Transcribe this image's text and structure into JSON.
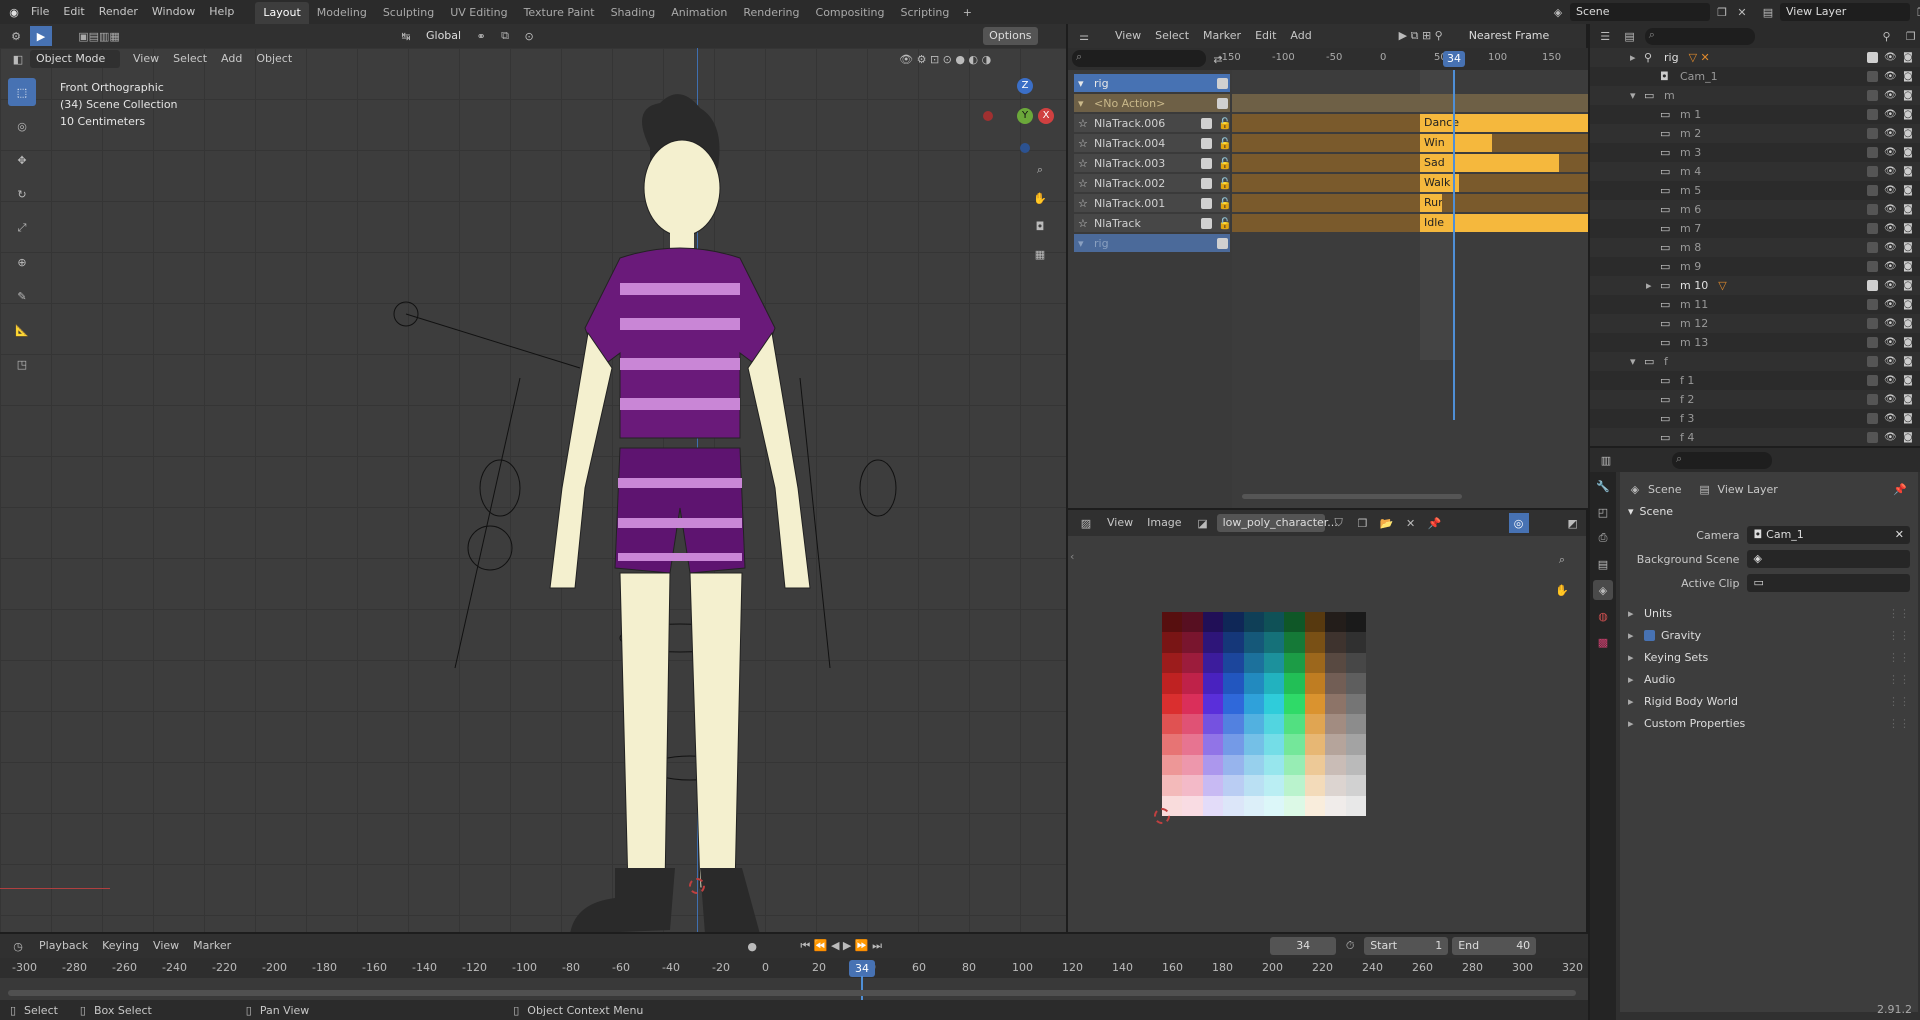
{
  "topbar": {
    "menus": [
      "File",
      "Edit",
      "Render",
      "Window",
      "Help"
    ],
    "workspaces": [
      "Layout",
      "Modeling",
      "Sculpting",
      "UV Editing",
      "Texture Paint",
      "Shading",
      "Animation",
      "Rendering",
      "Compositing",
      "Scripting"
    ],
    "active_workspace": "Layout",
    "scene": "Scene",
    "view_layer": "View Layer"
  },
  "viewport": {
    "mode": "Object Mode",
    "menus": [
      "View",
      "Select",
      "Add",
      "Object"
    ],
    "orientation": "Global",
    "options": "Options",
    "overlay_lines": [
      "Front Orthographic",
      "(34) Scene Collection",
      "10 Centimeters"
    ],
    "gizmo": {
      "z": "Z",
      "y": "Y",
      "x": "X"
    }
  },
  "nla": {
    "menus": [
      "View",
      "Select",
      "Marker",
      "Edit",
      "Add"
    ],
    "snap": "Nearest Frame",
    "ruler": [
      "-150",
      "-100",
      "-50",
      "0",
      "50",
      "100",
      "150"
    ],
    "current_frame": "34",
    "tracks": [
      {
        "name": "rig",
        "type": "object"
      },
      {
        "name": "<No Action>",
        "type": "action"
      },
      {
        "name": "NlaTrack.006",
        "strip": "Dance",
        "strip_frac": 1.0
      },
      {
        "name": "NlaTrack.004",
        "strip": "Win",
        "strip_frac": 0.43
      },
      {
        "name": "NlaTrack.003",
        "strip": "Sad",
        "strip_frac": 0.83
      },
      {
        "name": "NlaTrack.002",
        "strip": "Walk",
        "strip_frac": 0.23
      },
      {
        "name": "NlaTrack.001",
        "strip": "Run",
        "strip_frac": 0.12
      },
      {
        "name": "NlaTrack",
        "strip": "Idle",
        "strip_frac": 1.0
      },
      {
        "name": "rig",
        "type": "object2"
      }
    ]
  },
  "image_editor": {
    "menus": [
      "View",
      "Image"
    ],
    "image_name": "low_poly_character..."
  },
  "outliner": {
    "items": [
      {
        "label": "rig",
        "indent": 0,
        "expander": "▸",
        "icon": "armature-icon",
        "checked": true,
        "extra": "▽ ✕"
      },
      {
        "label": "Cam_1",
        "indent": 1,
        "icon": "camera-icon",
        "checked": false
      },
      {
        "label": "m",
        "indent": 0,
        "expander": "▾",
        "icon": "collection-icon",
        "checked": false
      },
      {
        "label": "m 1",
        "indent": 1,
        "icon": "collection-icon",
        "checked": false
      },
      {
        "label": "m 2",
        "indent": 1,
        "icon": "collection-icon",
        "checked": false
      },
      {
        "label": "m 3",
        "indent": 1,
        "icon": "collection-icon",
        "checked": false
      },
      {
        "label": "m 4",
        "indent": 1,
        "icon": "collection-icon",
        "checked": false
      },
      {
        "label": "m 5",
        "indent": 1,
        "icon": "collection-icon",
        "checked": false
      },
      {
        "label": "m 6",
        "indent": 1,
        "icon": "collection-icon",
        "checked": false
      },
      {
        "label": "m 7",
        "indent": 1,
        "icon": "collection-icon",
        "checked": false
      },
      {
        "label": "m 8",
        "indent": 1,
        "icon": "collection-icon",
        "checked": false
      },
      {
        "label": "m 9",
        "indent": 1,
        "icon": "collection-icon",
        "checked": false
      },
      {
        "label": "m 10",
        "indent": 1,
        "expander": "▸",
        "icon": "collection-icon",
        "checked": true,
        "extra": "▽"
      },
      {
        "label": "m 11",
        "indent": 1,
        "icon": "collection-icon",
        "checked": false
      },
      {
        "label": "m 12",
        "indent": 1,
        "icon": "collection-icon",
        "checked": false
      },
      {
        "label": "m 13",
        "indent": 1,
        "icon": "collection-icon",
        "checked": false
      },
      {
        "label": "f",
        "indent": 0,
        "expander": "▾",
        "icon": "collection-icon",
        "checked": false
      },
      {
        "label": "f 1",
        "indent": 1,
        "icon": "collection-icon",
        "checked": false
      },
      {
        "label": "f 2",
        "indent": 1,
        "icon": "collection-icon",
        "checked": false
      },
      {
        "label": "f 3",
        "indent": 1,
        "icon": "collection-icon",
        "checked": false
      },
      {
        "label": "f 4",
        "indent": 1,
        "icon": "collection-icon",
        "checked": false
      }
    ]
  },
  "properties": {
    "breadcrumb_scene": "Scene",
    "breadcrumb_layer": "View Layer",
    "panel": "Scene",
    "camera_label": "Camera",
    "camera_value": "Cam_1",
    "bg_label": "Background Scene",
    "clip_label": "Active Clip",
    "sections": [
      "Units",
      "Gravity",
      "Keying Sets",
      "Audio",
      "Rigid Body World",
      "Custom Properties"
    ],
    "gravity_checked": true
  },
  "timeline": {
    "menus": [
      "Playback",
      "Keying",
      "View",
      "Marker"
    ],
    "current": "34",
    "start_label": "Start",
    "start": "1",
    "end_label": "End",
    "end": "40",
    "ruler": [
      "-300",
      "-280",
      "-260",
      "-240",
      "-220",
      "-200",
      "-180",
      "-160",
      "-140",
      "-120",
      "-100",
      "-80",
      "-60",
      "-40",
      "-20",
      "0",
      "20",
      "40",
      "60",
      "80",
      "100",
      "120",
      "140",
      "160",
      "180",
      "200",
      "220",
      "240",
      "260",
      "280",
      "300",
      "320"
    ]
  },
  "statusbar": {
    "items": [
      "Select",
      "Box Select",
      "Pan View",
      "Object Context Menu"
    ],
    "version": "2.91.2"
  },
  "colors": {
    "accent": "#4772b3",
    "strip": "#f5b83d",
    "strip_dim": "#7a5a2c",
    "playhead": "#4f8fd6"
  }
}
